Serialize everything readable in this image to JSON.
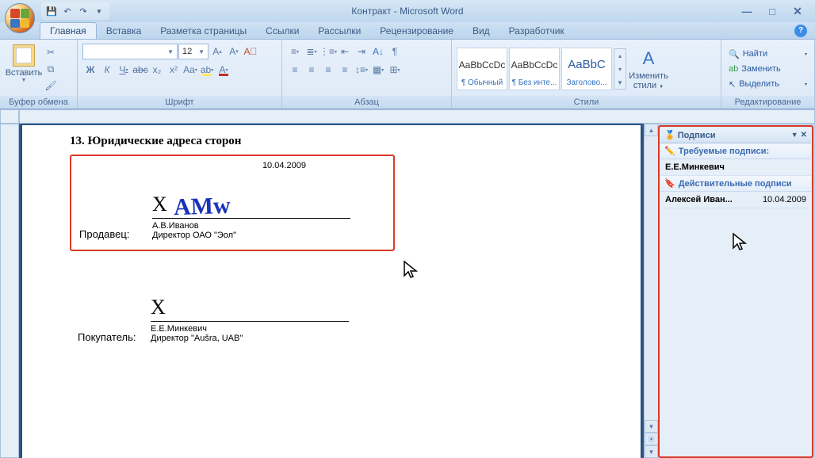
{
  "window": {
    "title": "Контракт - Microsoft Word"
  },
  "tabs": {
    "home": "Главная",
    "insert": "Вставка",
    "layout": "Разметка страницы",
    "references": "Ссылки",
    "mailings": "Рассылки",
    "review": "Рецензирование",
    "view": "Вид",
    "developer": "Разработчик"
  },
  "ribbon": {
    "clipboard": {
      "paste": "Вставить",
      "label": "Буфер обмена"
    },
    "font": {
      "name": "",
      "size": "12",
      "label": "Шрифт"
    },
    "paragraph": {
      "label": "Абзац"
    },
    "styles": {
      "s1_preview": "AaBbCcDc",
      "s1_name": "¶ Обычный",
      "s2_preview": "AaBbCcDc",
      "s2_name": "¶ Без инте...",
      "s3_preview": "AaBbC",
      "s3_name": "Заголово...",
      "change": "Изменить",
      "change2": "стили",
      "label": "Стили"
    },
    "editing": {
      "find": "Найти",
      "replace": "Заменить",
      "select": "Выделить",
      "label": "Редактирование"
    }
  },
  "document": {
    "heading": "13. Юридические адреса сторон",
    "sig1": {
      "date": "10.04.2009",
      "x": "X",
      "signature": "AMw",
      "name": "А.В.Иванов",
      "title": "Директор ОАО \"Эол\"",
      "role": "Продавец:"
    },
    "sig2": {
      "x": "X",
      "name": "Е.Е.Минкевич",
      "title": "Директор \"Aušra, UAB\"",
      "role": "Покупатель:"
    }
  },
  "sigpane": {
    "title": "Подписи",
    "required": "Требуемые подписи:",
    "req1": "Е.Е.Минкевич",
    "valid": "Действительные подписи",
    "valid1_name": "Алексей Иван...",
    "valid1_date": "10.04.2009"
  }
}
